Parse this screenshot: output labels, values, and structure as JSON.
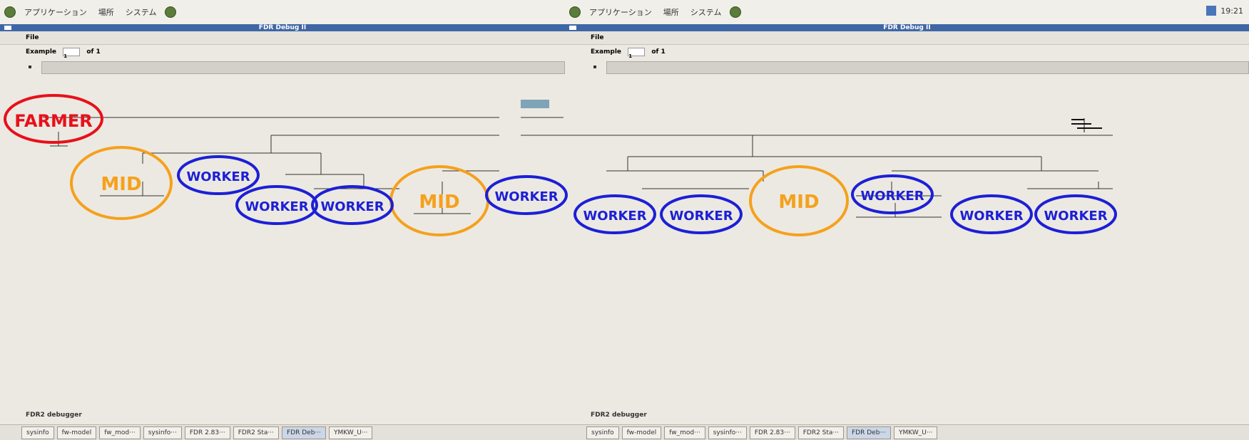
{
  "screens": [
    {
      "topbar": [
        "アプリケーション",
        "場所",
        "システム"
      ],
      "window_title": "FDR Debug II",
      "menu": "File",
      "example_label": "Example",
      "example_value": "1",
      "example_of": "of 1",
      "footer": "FDR2 debugger",
      "taskbar": [
        "sysinfo",
        "fw-model",
        "fw_mod···",
        "sysinfo···",
        "FDR 2.83···",
        "FDR2 Sta···",
        "FDR Deb···",
        "YMKW_U···"
      ]
    },
    {
      "topbar": [
        "アプリケーション",
        "場所",
        "システム"
      ],
      "clock": "19:21",
      "window_title": "FDR Debug II",
      "menu": "File",
      "example_label": "Example",
      "example_value": "1",
      "example_of": "of 1",
      "footer": "FDR2 debugger",
      "taskbar": [
        "sysinfo",
        "fw-model",
        "fw_mod···",
        "sysinfo···",
        "FDR 2.83···",
        "FDR2 Sta···",
        "FDR Deb···",
        "YMKW_U···"
      ]
    }
  ],
  "annotations": {
    "farmer": "FARMER",
    "mid": "MID",
    "worker": "WORKER"
  },
  "colors": {
    "farmer": "#e8101a",
    "mid": "#f5a11c",
    "worker": "#1c1fd6"
  }
}
